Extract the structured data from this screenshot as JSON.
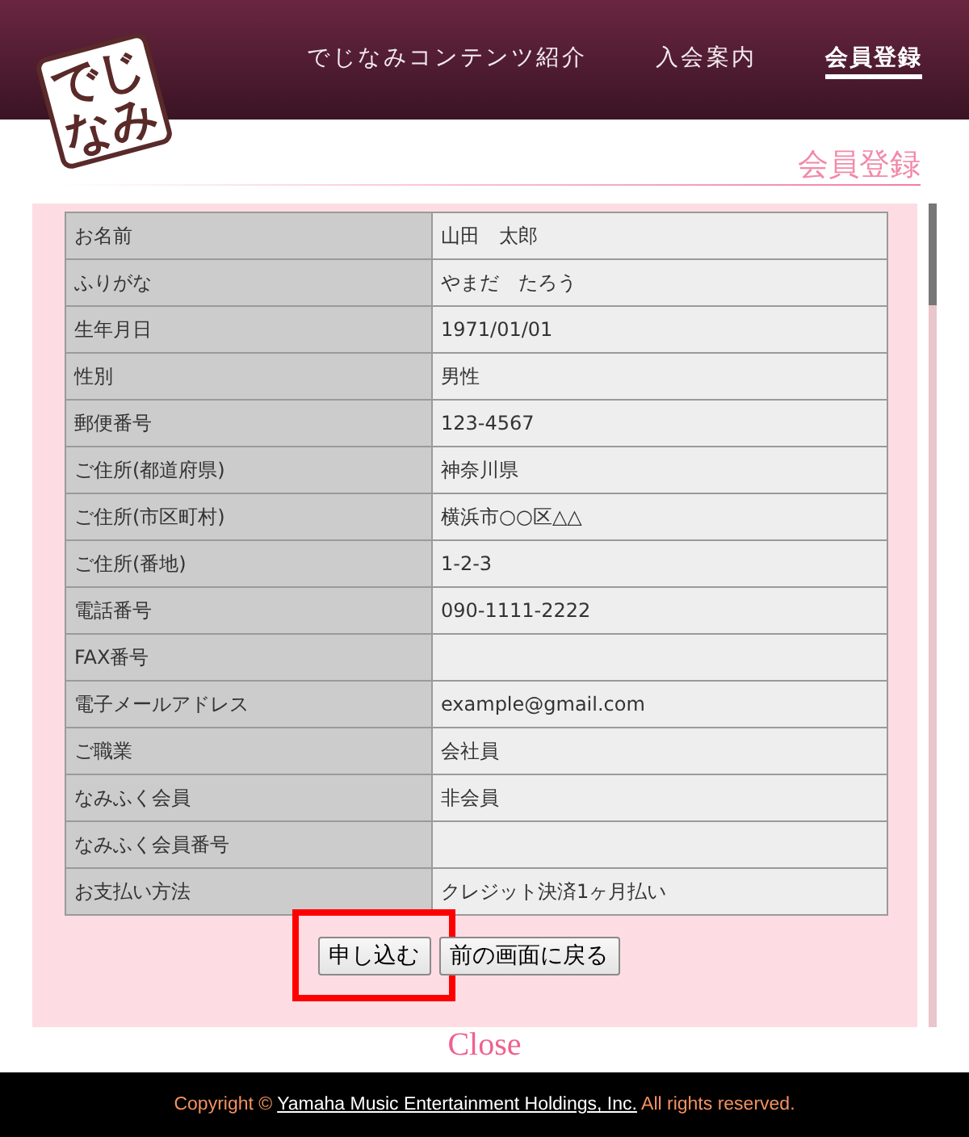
{
  "header": {
    "logo": {
      "lines": [
        "でじ",
        "なみ"
      ]
    },
    "nav": [
      {
        "label": "でじなみコンテンツ紹介",
        "selected": false
      },
      {
        "label": "入会案内",
        "selected": false
      },
      {
        "label": "会員登録",
        "selected": true
      }
    ]
  },
  "page_title": "会員登録",
  "table": {
    "rows": [
      {
        "label": "お名前",
        "value": "山田　太郎"
      },
      {
        "label": "ふりがな",
        "value": "やまだ　たろう"
      },
      {
        "label": "生年月日",
        "value": "1971/01/01"
      },
      {
        "label": "性別",
        "value": "男性"
      },
      {
        "label": "郵便番号",
        "value": "123-4567"
      },
      {
        "label": "ご住所(都道府県)",
        "value": "神奈川県"
      },
      {
        "label": "ご住所(市区町村)",
        "value": "横浜市○○区△△"
      },
      {
        "label": "ご住所(番地)",
        "value": "1-2-3"
      },
      {
        "label": "電話番号",
        "value": "090-1111-2222"
      },
      {
        "label": "FAX番号"
      },
      {
        "label": "電子メールアドレス",
        "value": "example@gmail.com"
      },
      {
        "label": "ご職業",
        "value": "会社員"
      },
      {
        "label": "なみふく会員",
        "value": "非会員"
      },
      {
        "label": "なみふく会員番号"
      },
      {
        "label": "お支払い方法",
        "value": "クレジット決済1ヶ月払い"
      }
    ]
  },
  "buttons": [
    {
      "label": "申し込む",
      "highlighted": true
    },
    {
      "label": "前の画面に戻る",
      "highlighted": false
    }
  ],
  "close_link": "Close",
  "footer": {
    "prefix": "Copyright ©",
    "link": "Yamaha Music Entertainment Holdings, Inc.",
    "suffix": "All rights reserved."
  }
}
